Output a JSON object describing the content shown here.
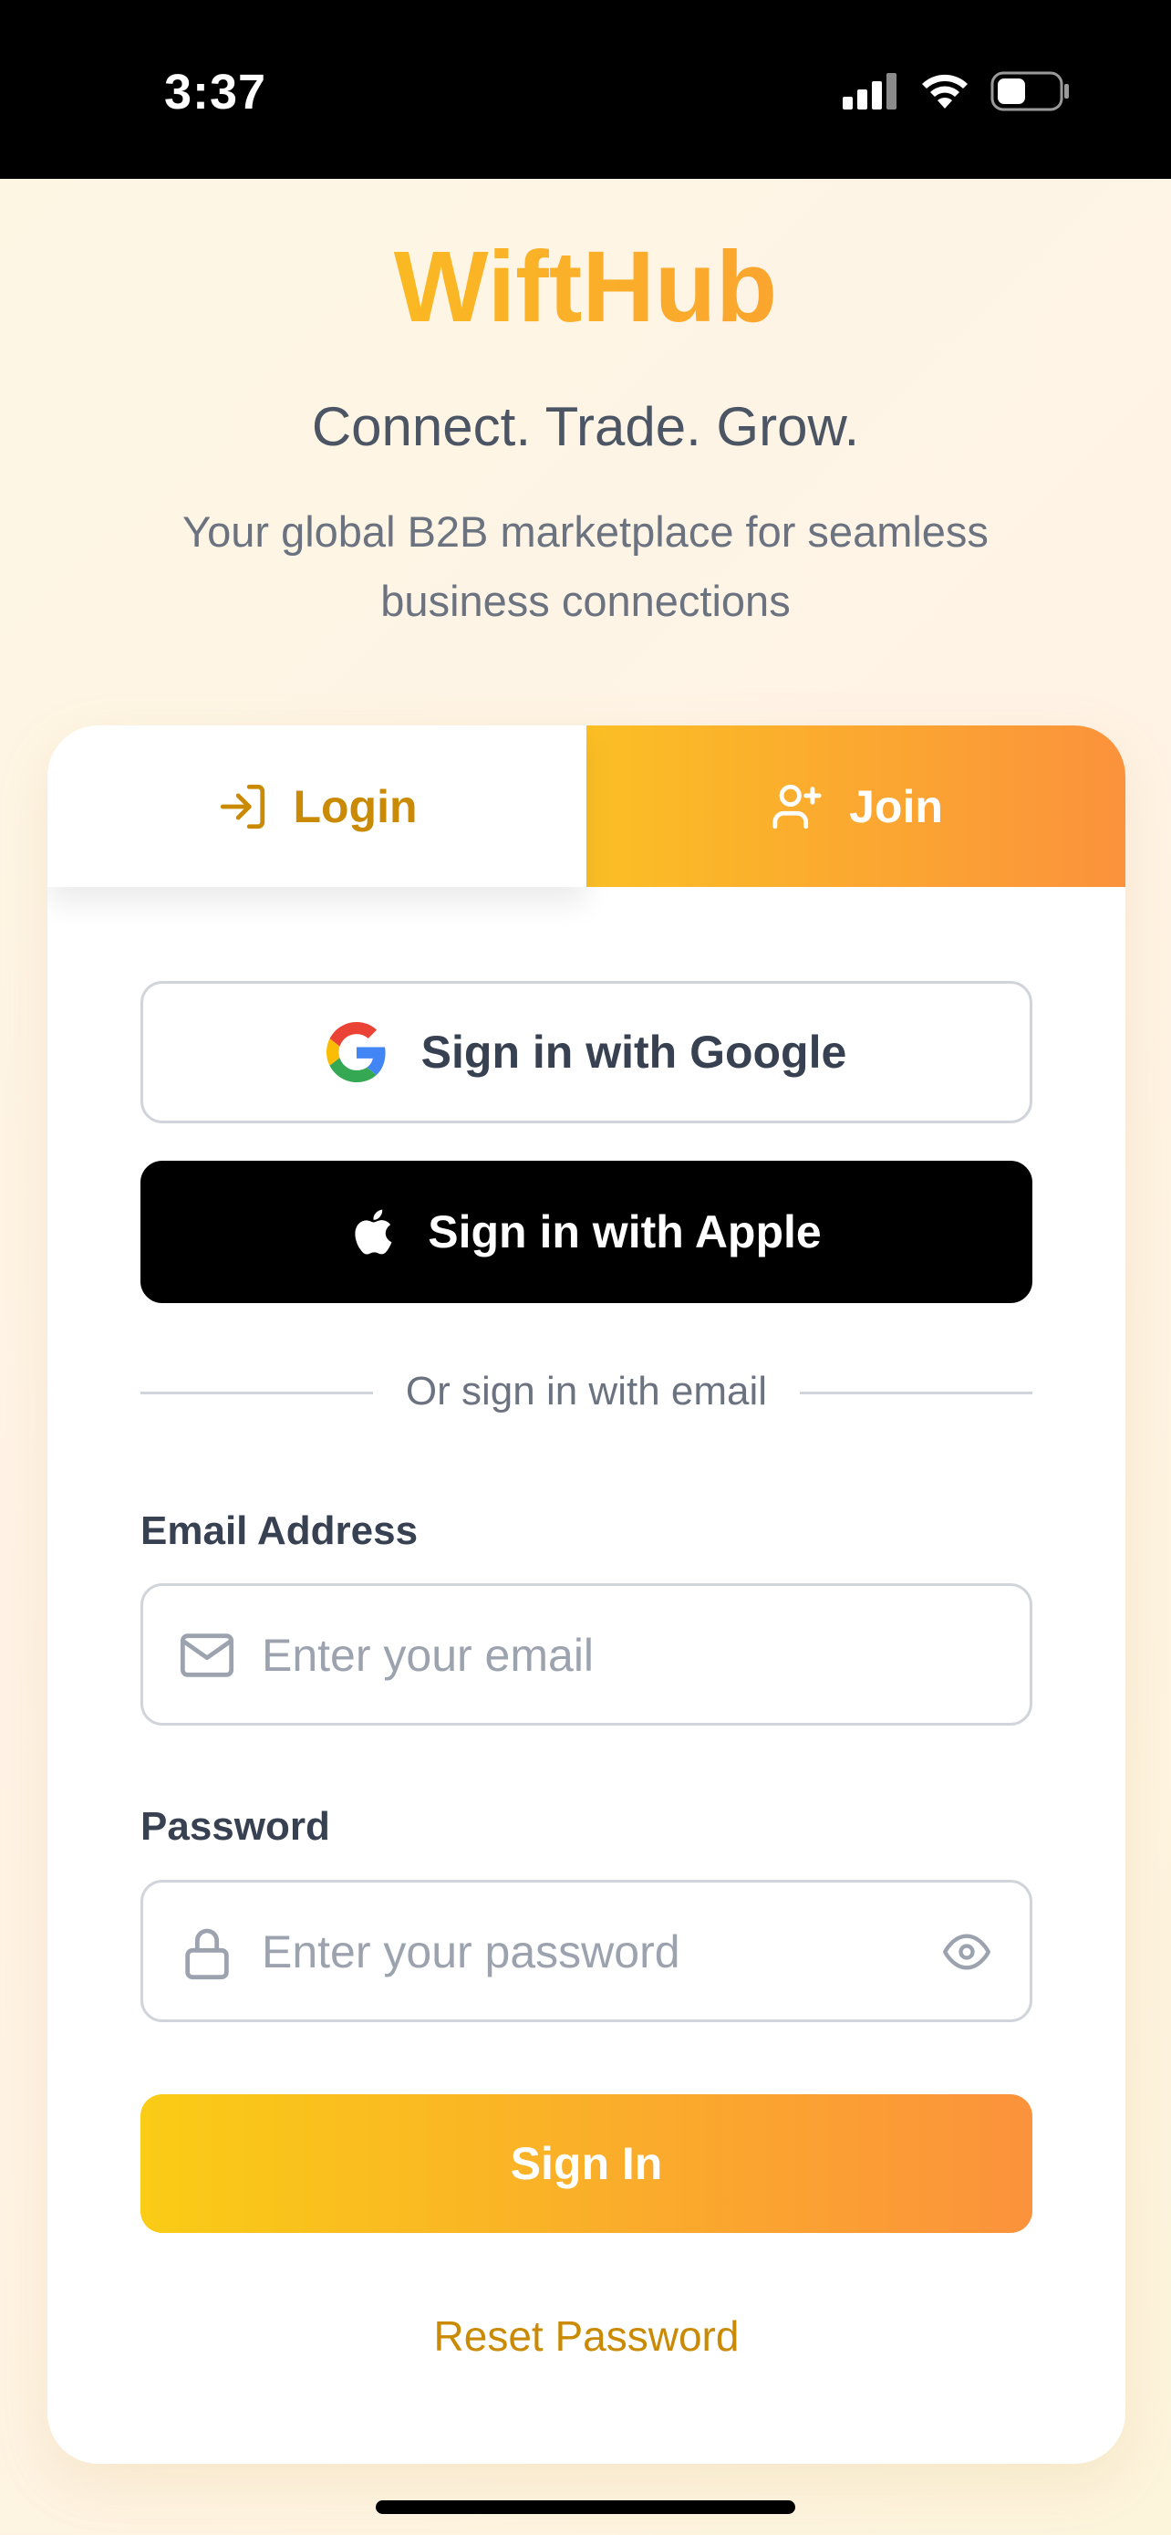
{
  "status_bar": {
    "time": "3:37"
  },
  "brand": {
    "name": "WiftHub"
  },
  "hero": {
    "tagline": "Connect. Trade. Grow.",
    "subtitle": "Your global B2B marketplace for seamless business connections"
  },
  "tabs": [
    {
      "label": "Login",
      "icon": "login-icon",
      "active": true
    },
    {
      "label": "Join",
      "icon": "user-plus-icon",
      "active": false
    }
  ],
  "social": {
    "google_label": "Sign in with Google",
    "apple_label": "Sign in with Apple"
  },
  "divider": {
    "text": "Or sign in with email"
  },
  "form": {
    "email_label": "Email Address",
    "email_placeholder": "Enter your email",
    "password_label": "Password",
    "password_placeholder": "Enter your password"
  },
  "actions": {
    "sign_in_label": "Sign In",
    "reset_label": "Reset Password"
  },
  "colors": {
    "accent_start": "#facc15",
    "accent_end": "#fb923c",
    "link": "#ca8a04"
  }
}
